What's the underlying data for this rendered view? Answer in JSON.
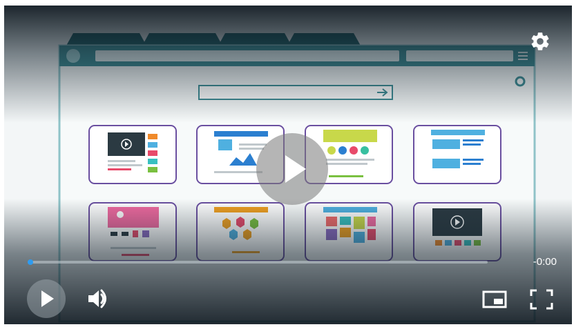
{
  "player": {
    "time_display": "-0:00",
    "progress": 0,
    "accent_color": "#2e9bf0"
  },
  "icons": {
    "settings": "gear-icon",
    "big_play": "play-icon",
    "play": "play-icon",
    "volume": "volume-icon",
    "pip": "picture-in-picture-icon",
    "fullscreen": "fullscreen-icon"
  }
}
